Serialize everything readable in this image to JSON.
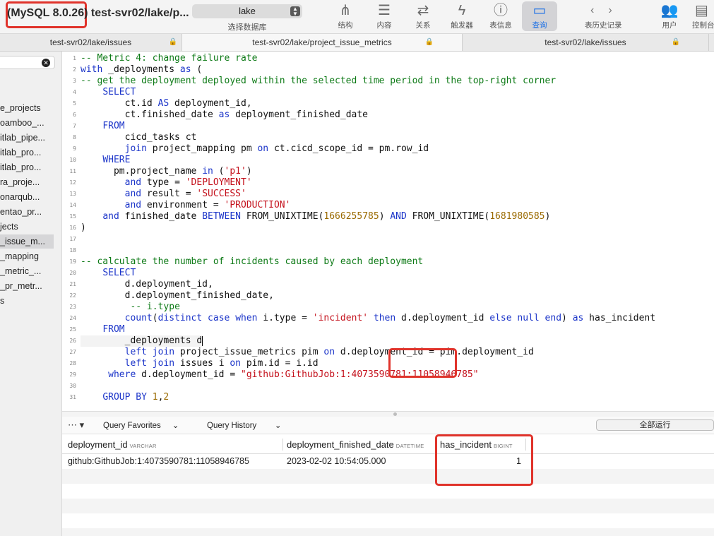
{
  "toolbar": {
    "window_title": "(MySQL 8.0.26) test-svr02/lake/p...",
    "database": "lake",
    "database_caption": "选择数据库",
    "buttons": [
      {
        "label": "结构",
        "icon": "structure-icon"
      },
      {
        "label": "内容",
        "icon": "content-icon"
      },
      {
        "label": "关系",
        "icon": "relations-icon"
      },
      {
        "label": "触发器",
        "icon": "triggers-icon"
      },
      {
        "label": "表信息",
        "icon": "table-info-icon"
      },
      {
        "label": "查询",
        "icon": "query-icon",
        "active": true
      }
    ],
    "history_label": "表历史记录",
    "user_label": "用户",
    "console_label": "控制台"
  },
  "tabs": [
    {
      "label": "test-svr02/lake/issues"
    },
    {
      "label": "test-svr02/lake/project_issue_metrics",
      "active": true
    },
    {
      "label": "test-svr02/lake/issues"
    }
  ],
  "sidebar": {
    "items": [
      "e_projects",
      "oamboo_...",
      "itlab_pipe...",
      "itlab_pro...",
      "itlab_pro...",
      "ra_proje...",
      "onarqub...",
      "entao_pr...",
      "jects",
      "_issue_m...",
      "_mapping",
      "_metric_...",
      "_pr_metr...",
      "s"
    ],
    "selected_index": 9
  },
  "editor": {
    "lines": [
      "-- Metric 4: change failure rate",
      "with _deployments as (",
      "-- get the deployment deployed within the selected time period in the top-right corner",
      "    SELECT",
      "        ct.id AS deployment_id,",
      "        ct.finished_date as deployment_finished_date",
      "    FROM",
      "        cicd_tasks ct",
      "        join project_mapping pm on ct.cicd_scope_id = pm.row_id",
      "    WHERE",
      "      pm.project_name in ('p1')",
      "        and type = 'DEPLOYMENT'",
      "        and result = 'SUCCESS'",
      "        and environment = 'PRODUCTION'",
      "    and finished_date BETWEEN FROM_UNIXTIME(1666255785) AND FROM_UNIXTIME(1681980585)",
      ")",
      "",
      "",
      "-- calculate the number of incidents caused by each deployment",
      "    SELECT",
      "        d.deployment_id,",
      "        d.deployment_finished_date,",
      "         -- i.type",
      "        count(distinct case when i.type = 'incident' then d.deployment_id else null end) as has_incident",
      "    FROM",
      "        _deployments d",
      "        left join project_issue_metrics pim on d.deployment_id = pim.deployment_id",
      "        left join issues i on pim.id = i.id",
      "     where d.deployment_id = \"github:GithubJob:1:4073590781:11058946785\"",
      "",
      "    GROUP BY 1,2"
    ]
  },
  "query_bar": {
    "favorites": "Query Favorites",
    "history": "Query History",
    "run_all": "全部运行"
  },
  "results": {
    "columns": [
      {
        "name": "deployment_id",
        "type": "VARCHAR"
      },
      {
        "name": "deployment_finished_date",
        "type": "DATETIME"
      },
      {
        "name": "has_incident",
        "type": "BIGINT"
      }
    ],
    "rows": [
      [
        "github:GithubJob:1:4073590781:11058946785",
        "2023-02-02 10:54:05.000",
        "1"
      ]
    ]
  },
  "colors": {
    "highlight": "#e0332b",
    "keyword": "#1c35c9",
    "comment": "#0d7a16",
    "string": "#c4111c",
    "number": "#9a6a00",
    "active_tool": "#1a6fe6"
  }
}
